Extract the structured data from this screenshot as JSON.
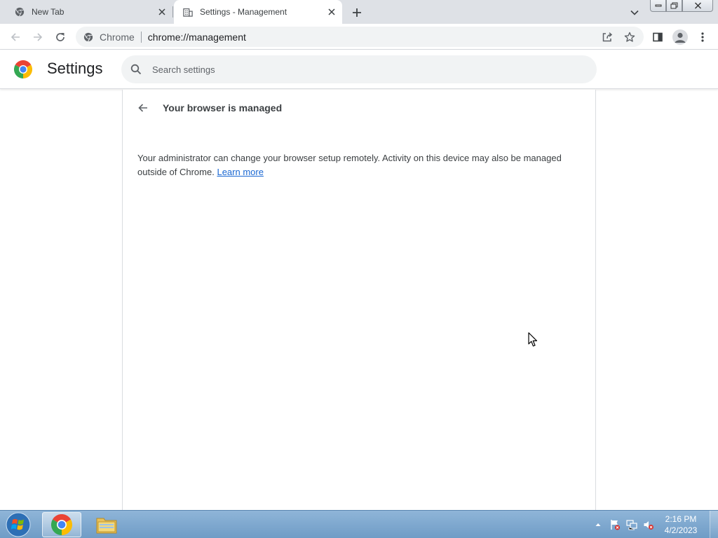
{
  "tabs": [
    {
      "title": "New Tab",
      "icon": "chrome-icon",
      "active": false
    },
    {
      "title": "Settings - Management",
      "icon": "building-icon",
      "active": true
    }
  ],
  "omnibox": {
    "chip": "Chrome",
    "url": "chrome://management"
  },
  "header": {
    "title": "Settings",
    "search_placeholder": "Search settings"
  },
  "page": {
    "title": "Your browser is managed",
    "description": "Your administrator can change your browser setup remotely. Activity on this device may also be managed outside of Chrome.",
    "link": "Learn more"
  },
  "taskbar": {
    "time": "2:16 PM",
    "date": "4/2/2023"
  },
  "colors": {
    "accent": "#1a73e8",
    "link": "#1967d2",
    "tabstrip": "#dee1e6",
    "taskbar": "#7fa8d0"
  }
}
